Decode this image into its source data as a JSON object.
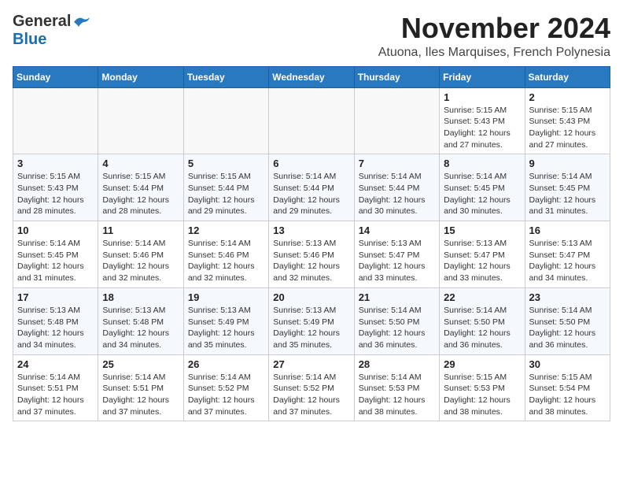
{
  "logo": {
    "general": "General",
    "blue": "Blue"
  },
  "title": "November 2024",
  "subtitle": "Atuona, Iles Marquises, French Polynesia",
  "headers": [
    "Sunday",
    "Monday",
    "Tuesday",
    "Wednesday",
    "Thursday",
    "Friday",
    "Saturday"
  ],
  "weeks": [
    [
      {
        "day": "",
        "info": ""
      },
      {
        "day": "",
        "info": ""
      },
      {
        "day": "",
        "info": ""
      },
      {
        "day": "",
        "info": ""
      },
      {
        "day": "",
        "info": ""
      },
      {
        "day": "1",
        "info": "Sunrise: 5:15 AM\nSunset: 5:43 PM\nDaylight: 12 hours and 27 minutes."
      },
      {
        "day": "2",
        "info": "Sunrise: 5:15 AM\nSunset: 5:43 PM\nDaylight: 12 hours and 27 minutes."
      }
    ],
    [
      {
        "day": "3",
        "info": "Sunrise: 5:15 AM\nSunset: 5:43 PM\nDaylight: 12 hours and 28 minutes."
      },
      {
        "day": "4",
        "info": "Sunrise: 5:15 AM\nSunset: 5:44 PM\nDaylight: 12 hours and 28 minutes."
      },
      {
        "day": "5",
        "info": "Sunrise: 5:15 AM\nSunset: 5:44 PM\nDaylight: 12 hours and 29 minutes."
      },
      {
        "day": "6",
        "info": "Sunrise: 5:14 AM\nSunset: 5:44 PM\nDaylight: 12 hours and 29 minutes."
      },
      {
        "day": "7",
        "info": "Sunrise: 5:14 AM\nSunset: 5:44 PM\nDaylight: 12 hours and 30 minutes."
      },
      {
        "day": "8",
        "info": "Sunrise: 5:14 AM\nSunset: 5:45 PM\nDaylight: 12 hours and 30 minutes."
      },
      {
        "day": "9",
        "info": "Sunrise: 5:14 AM\nSunset: 5:45 PM\nDaylight: 12 hours and 31 minutes."
      }
    ],
    [
      {
        "day": "10",
        "info": "Sunrise: 5:14 AM\nSunset: 5:45 PM\nDaylight: 12 hours and 31 minutes."
      },
      {
        "day": "11",
        "info": "Sunrise: 5:14 AM\nSunset: 5:46 PM\nDaylight: 12 hours and 32 minutes."
      },
      {
        "day": "12",
        "info": "Sunrise: 5:14 AM\nSunset: 5:46 PM\nDaylight: 12 hours and 32 minutes."
      },
      {
        "day": "13",
        "info": "Sunrise: 5:13 AM\nSunset: 5:46 PM\nDaylight: 12 hours and 32 minutes."
      },
      {
        "day": "14",
        "info": "Sunrise: 5:13 AM\nSunset: 5:47 PM\nDaylight: 12 hours and 33 minutes."
      },
      {
        "day": "15",
        "info": "Sunrise: 5:13 AM\nSunset: 5:47 PM\nDaylight: 12 hours and 33 minutes."
      },
      {
        "day": "16",
        "info": "Sunrise: 5:13 AM\nSunset: 5:47 PM\nDaylight: 12 hours and 34 minutes."
      }
    ],
    [
      {
        "day": "17",
        "info": "Sunrise: 5:13 AM\nSunset: 5:48 PM\nDaylight: 12 hours and 34 minutes."
      },
      {
        "day": "18",
        "info": "Sunrise: 5:13 AM\nSunset: 5:48 PM\nDaylight: 12 hours and 34 minutes."
      },
      {
        "day": "19",
        "info": "Sunrise: 5:13 AM\nSunset: 5:49 PM\nDaylight: 12 hours and 35 minutes."
      },
      {
        "day": "20",
        "info": "Sunrise: 5:13 AM\nSunset: 5:49 PM\nDaylight: 12 hours and 35 minutes."
      },
      {
        "day": "21",
        "info": "Sunrise: 5:14 AM\nSunset: 5:50 PM\nDaylight: 12 hours and 36 minutes."
      },
      {
        "day": "22",
        "info": "Sunrise: 5:14 AM\nSunset: 5:50 PM\nDaylight: 12 hours and 36 minutes."
      },
      {
        "day": "23",
        "info": "Sunrise: 5:14 AM\nSunset: 5:50 PM\nDaylight: 12 hours and 36 minutes."
      }
    ],
    [
      {
        "day": "24",
        "info": "Sunrise: 5:14 AM\nSunset: 5:51 PM\nDaylight: 12 hours and 37 minutes."
      },
      {
        "day": "25",
        "info": "Sunrise: 5:14 AM\nSunset: 5:51 PM\nDaylight: 12 hours and 37 minutes."
      },
      {
        "day": "26",
        "info": "Sunrise: 5:14 AM\nSunset: 5:52 PM\nDaylight: 12 hours and 37 minutes."
      },
      {
        "day": "27",
        "info": "Sunrise: 5:14 AM\nSunset: 5:52 PM\nDaylight: 12 hours and 37 minutes."
      },
      {
        "day": "28",
        "info": "Sunrise: 5:14 AM\nSunset: 5:53 PM\nDaylight: 12 hours and 38 minutes."
      },
      {
        "day": "29",
        "info": "Sunrise: 5:15 AM\nSunset: 5:53 PM\nDaylight: 12 hours and 38 minutes."
      },
      {
        "day": "30",
        "info": "Sunrise: 5:15 AM\nSunset: 5:54 PM\nDaylight: 12 hours and 38 minutes."
      }
    ]
  ]
}
